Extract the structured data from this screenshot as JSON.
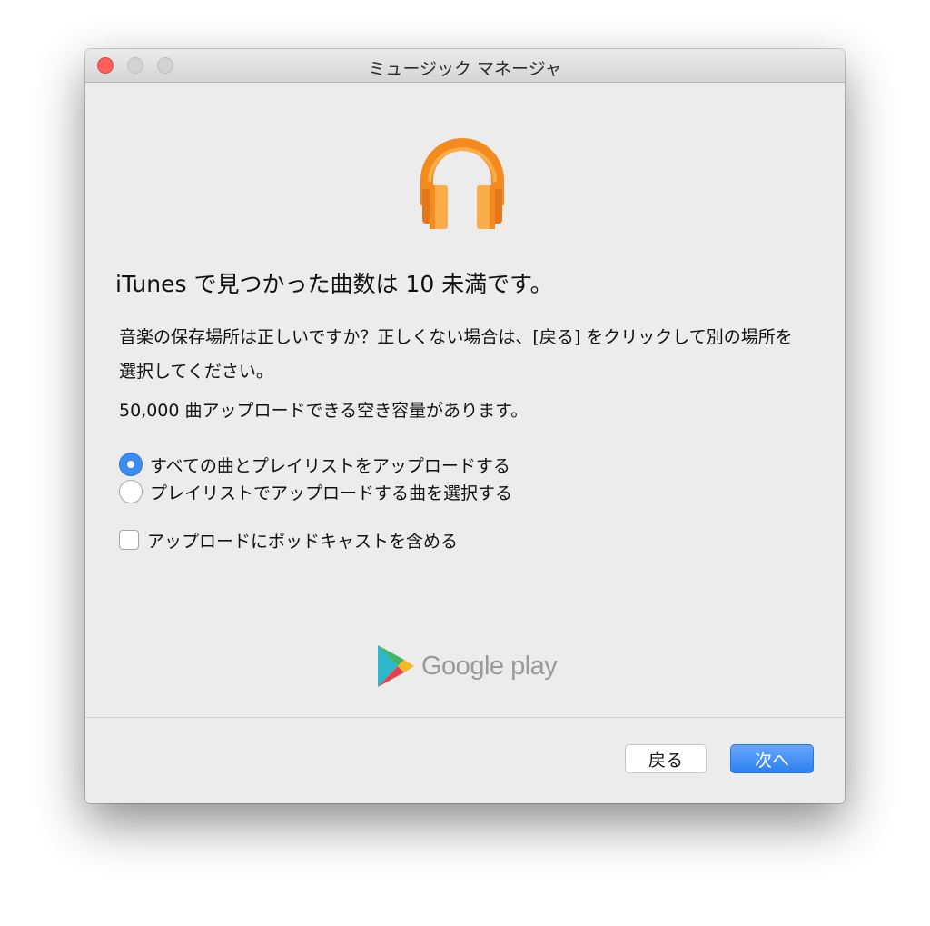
{
  "window": {
    "title": "ミュージック マネージャ"
  },
  "content": {
    "heading": "iTunes で見つかった曲数は 10 未満です。",
    "description": "音楽の保存場所は正しいですか？正しくない場合は、[戻る] をクリックして別の場所を選択してください。",
    "capacity": "50,000 曲アップロードできる空き容量があります。"
  },
  "options": {
    "radio_all": {
      "label": "すべての曲とプレイリストをアップロードする",
      "selected": true
    },
    "radio_select": {
      "label": "プレイリストでアップロードする曲を選択する",
      "selected": false
    },
    "podcasts": {
      "label": "アップロードにポッドキャストを含める",
      "checked": false
    }
  },
  "branding": {
    "logo_text": "Google play"
  },
  "buttons": {
    "back": "戻る",
    "next": "次へ"
  },
  "icons": {
    "app": "headphones-icon",
    "brand": "google-play-icon"
  },
  "colors": {
    "accent": "#3b8cf0",
    "headphones": "#f58a1f",
    "close": "#fc605b"
  }
}
